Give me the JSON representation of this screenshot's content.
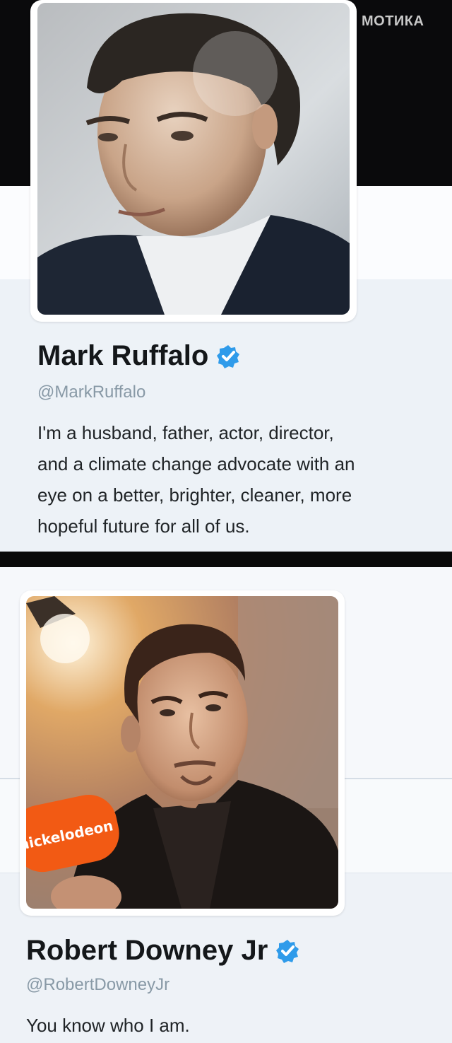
{
  "watermark": "МОТИКА",
  "profiles": [
    {
      "name": "Mark Ruffalo",
      "handle": "@MarkRuffalo",
      "verified": true,
      "avatar": "portrait-photo",
      "bio_lines": [
        "I'm a husband, father, actor, director,",
        "and a climate change advocate with an",
        "eye on a better, brighter, cleaner, more",
        "hopeful future for all of us."
      ]
    },
    {
      "name": "Robert Downey Jr",
      "handle": "@RobertDowneyJr",
      "verified": true,
      "avatar": "portrait-photo",
      "microphone_text": "nickelodeon",
      "bio_lines": [
        "You know who I am."
      ]
    }
  ],
  "colors": {
    "verified_badge": "#2f9bea",
    "name_text": "#14171a",
    "handle_text": "#8899a6",
    "profile_background": "#edf2f7",
    "separator": "#0a0a0a"
  }
}
